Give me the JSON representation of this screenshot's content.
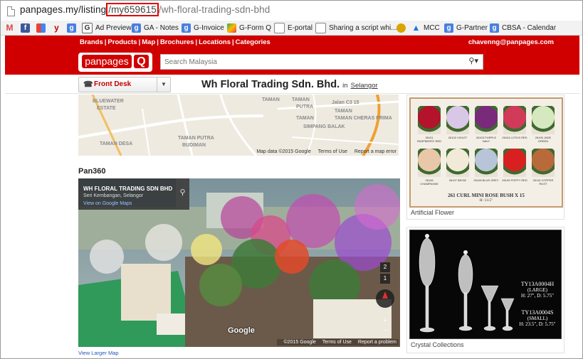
{
  "browser": {
    "url_host": "panpages.my/listing",
    "url_highlight": "/my659615",
    "url_tail": "/wh-floral-trading-sdn-bhd"
  },
  "bookmarks": [
    {
      "label": "",
      "icon": "gmail-icon"
    },
    {
      "label": "",
      "icon": "facebook-icon"
    },
    {
      "label": "",
      "icon": "google-apps-icon"
    },
    {
      "label": "",
      "icon": "yahoo-icon"
    },
    {
      "label": "",
      "icon": "google-icon"
    },
    {
      "label": "Ad Preview",
      "icon": "ad-preview-icon"
    },
    {
      "label": "GA - Notes",
      "icon": "google-icon"
    },
    {
      "label": "G-Invoice",
      "icon": "google-icon"
    },
    {
      "label": "G-Form Q",
      "icon": "apps-icon"
    },
    {
      "label": "E-portal",
      "icon": "page-icon"
    },
    {
      "label": "Sharing a script whi...",
      "icon": "page-icon"
    },
    {
      "label": "",
      "icon": "gold-icon"
    },
    {
      "label": "MCC",
      "icon": "adwords-icon"
    },
    {
      "label": "G-Partner",
      "icon": "google-icon"
    },
    {
      "label": "CBSA - Calendar",
      "icon": "google-icon"
    }
  ],
  "header": {
    "nav": [
      "Brands",
      "Products",
      "Map",
      "Brochures",
      "Locations",
      "Categories"
    ],
    "email": "chavenng@panpages.com",
    "logo_text": "panpages",
    "logo_q": "Q",
    "search_placeholder": "Search Malaysia"
  },
  "toolbar": {
    "front_desk": "Front Desk",
    "company_name": "Wh Floral Trading Sdn. Bhd.",
    "in_text": "in",
    "location": "Selangor"
  },
  "map": {
    "labels": [
      "BLUEWATER",
      "ESTATE",
      "TAMAN",
      "TAMAN",
      "PUTRA",
      "Jalan C3 15",
      "TAMAN",
      "SIMPANG BALAK",
      "TAMAN",
      "TAMAN CHERAS PRIMA",
      "TAMAN DESA",
      "TAMAN PUTRA",
      "BUDIMAN"
    ],
    "footer": [
      "Map data ©2015 Google",
      "Terms of Use",
      "Report a map error"
    ]
  },
  "pan360": {
    "heading": "Pan360",
    "title": "WH FLORAL TRADING SDN BHD",
    "subtitle": "Seri Kembangan, Selangor",
    "link": "View on Google Maps",
    "footer": [
      "©2015 Google",
      "Terms of Use",
      "Report a problem"
    ],
    "watermark": "Google",
    "view_larger": "View Larger Map",
    "controls": [
      "2",
      "1",
      "+",
      "−"
    ]
  },
  "cards": [
    {
      "caption": "Artificial Flower",
      "product_title": "261 CURL MINI ROSE BUSH X 15",
      "product_sub": "H: 13.5\"",
      "swatches": [
        {
          "label": "26101 RASPBERRY RED",
          "color": "#b3142b"
        },
        {
          "label": "26102 VIOLET",
          "color": "#d9c7e8"
        },
        {
          "label": "26103 PURPLE NAVY",
          "color": "#7a2a7a"
        },
        {
          "label": "26104 LOTUS RED",
          "color": "#d23a5a"
        },
        {
          "label": "26105 JADE GREEN",
          "color": "#d6e8c0"
        },
        {
          "label": "26106 CHAMPAGNE",
          "color": "#e8c8a8"
        },
        {
          "label": "26107 BEIGE",
          "color": "#f2ead8"
        },
        {
          "label": "26108 BLUE GREY",
          "color": "#b8c4d8"
        },
        {
          "label": "26109 POPPY RED",
          "color": "#d92020"
        },
        {
          "label": "26110 COPPER RUST",
          "color": "#b86a3a"
        }
      ]
    },
    {
      "caption": "Crystal Collections",
      "large_code": "TY13A0004H",
      "large_size": "(LARGE)",
      "large_dim": "H: 27\", D: 5.75\"",
      "small_code": "TY13A0004S",
      "small_size": "(SMALL)",
      "small_dim": "H: 23.5\", D: 5.75\""
    }
  ]
}
